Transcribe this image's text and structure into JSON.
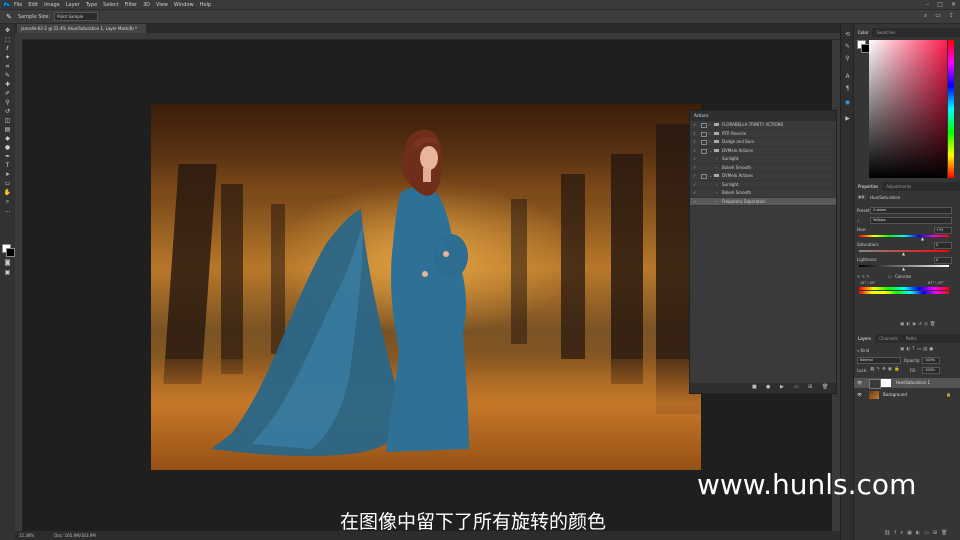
{
  "menubar": {
    "app_icon": "Ps",
    "items": [
      "File",
      "Edit",
      "Image",
      "Layer",
      "Type",
      "Select",
      "Filter",
      "3D",
      "View",
      "Window",
      "Help"
    ]
  },
  "options_bar": {
    "sample_size_label": "Sample Size:",
    "sample_size_value": "Point Sample"
  },
  "document": {
    "tab_title": "jancelle-62-2 @ 22.4% (Hue/Saturation 1, Layer Mask/8) *",
    "zoom": "22.38%",
    "doc_size": "Doc: 165.9M/163.9M"
  },
  "actions_panel": {
    "title": "Actions",
    "rows": [
      {
        "name": "FLORABELLA TRINITY ACTIONS",
        "folder": true
      },
      {
        "name": "RTR Reverie",
        "folder": true
      },
      {
        "name": "Dodge and Burn",
        "folder": true
      },
      {
        "name": "DVMelo Actions",
        "folder": true
      },
      {
        "name": "Sunlight",
        "folder": false
      },
      {
        "name": "Bokeh Smooth",
        "folder": false
      },
      {
        "name": "DVMelo Actions",
        "folder": true
      },
      {
        "name": "Sunlight",
        "folder": false
      },
      {
        "name": "Bokeh Smooth",
        "folder": false
      },
      {
        "name": "Frequency Separation",
        "folder": false,
        "selected": true
      }
    ]
  },
  "color_panel": {
    "tabs": [
      "Color",
      "Swatches"
    ],
    "foreground": "#ffffff",
    "background": "#000000"
  },
  "properties_panel": {
    "tabs": [
      "Properties",
      "Adjustments"
    ],
    "title": "Hue/Saturation",
    "preset_label": "Preset:",
    "preset_value": "Custom",
    "channel_value": "Yellows",
    "hue_label": "Hue:",
    "hue_value": "+33",
    "saturation_label": "Saturation:",
    "saturation_value": "0",
    "lightness_label": "Lightness:",
    "lightness_value": "0",
    "colorize_label": "Colorize",
    "range_left": "15° / 45°",
    "range_right": "67° \\ 97°"
  },
  "layers_panel": {
    "tabs": [
      "Layers",
      "Channels",
      "Paths"
    ],
    "kind_label": "Kind",
    "blend_mode": "Normal",
    "opacity_label": "Opacity:",
    "opacity_value": "100%",
    "lock_label": "Lock:",
    "fill_label": "Fill:",
    "fill_value": "100%",
    "layers": [
      {
        "name": "Hue/Saturation 1",
        "selected": true
      },
      {
        "name": "Background",
        "selected": false
      }
    ]
  },
  "watermark": "www.hunls.com",
  "subtitle": "在图像中留下了所有旋转的颜色",
  "colors": {
    "accent": "#31a8ff",
    "dress": "#2f6f93"
  }
}
